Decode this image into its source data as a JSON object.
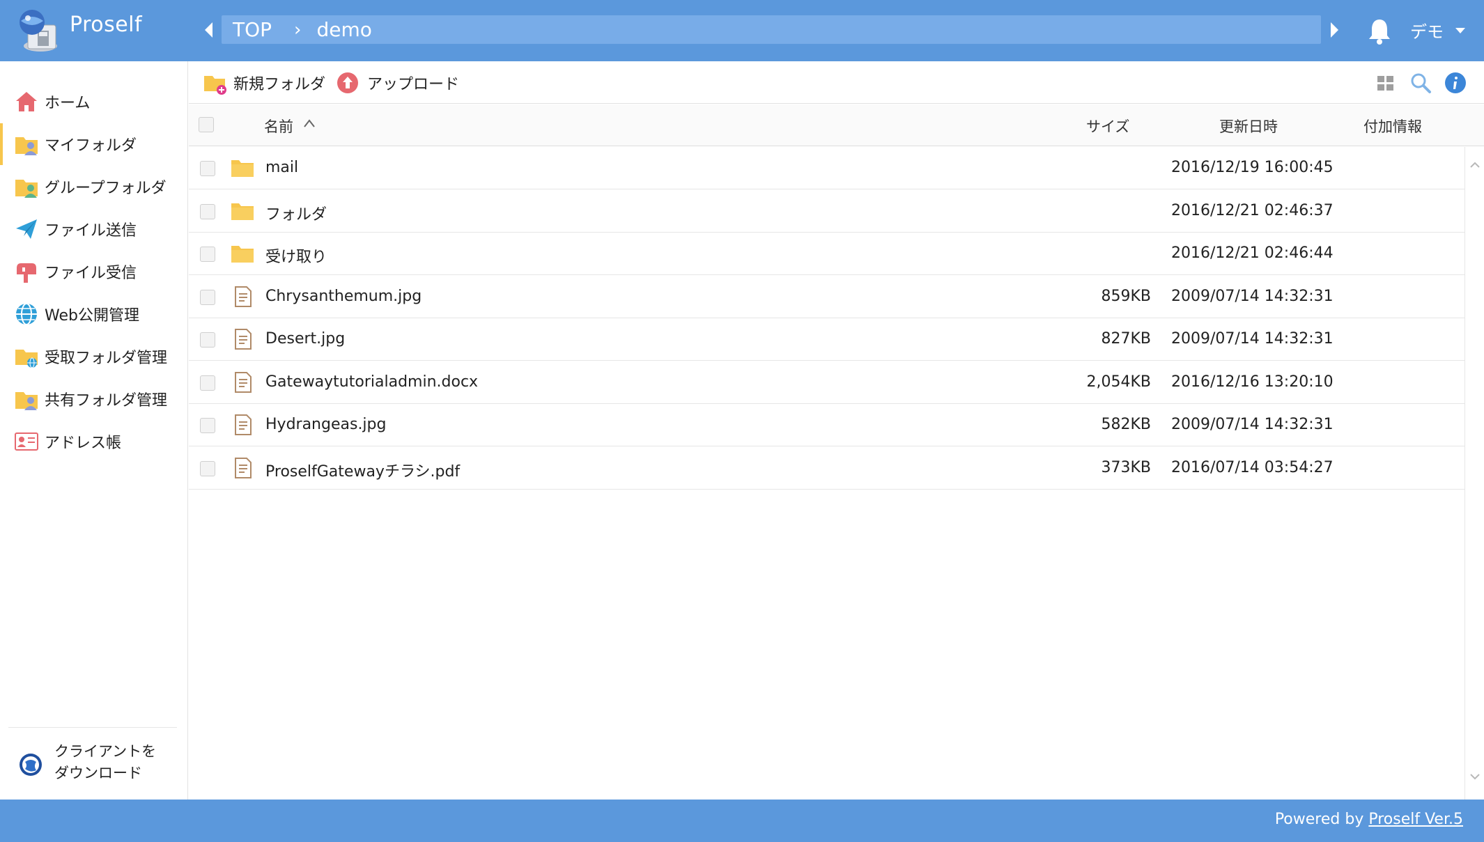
{
  "header": {
    "app_title": "Proself",
    "breadcrumbs": [
      "TOP",
      "demo"
    ],
    "user_label": "デモ"
  },
  "sidebar": {
    "items": [
      {
        "label": "ホーム",
        "icon": "home-icon"
      },
      {
        "label": "マイフォルダ",
        "icon": "my-folder-icon"
      },
      {
        "label": "グループフォルダ",
        "icon": "group-folder-icon"
      },
      {
        "label": "ファイル送信",
        "icon": "send-icon"
      },
      {
        "label": "ファイル受信",
        "icon": "mailbox-icon"
      },
      {
        "label": "Web公開管理",
        "icon": "globe-icon"
      },
      {
        "label": "受取フォルダ管理",
        "icon": "receive-folder-icon"
      },
      {
        "label": "共有フォルダ管理",
        "icon": "shared-folder-icon"
      },
      {
        "label": "アドレス帳",
        "icon": "address-book-icon"
      }
    ],
    "client_download": {
      "line1": "クライアントを",
      "line2": "ダウンロード"
    }
  },
  "toolbar": {
    "new_folder": "新規フォルダ",
    "upload": "アップロード"
  },
  "table": {
    "columns": {
      "name": "名前",
      "size": "サイズ",
      "updated": "更新日時",
      "extra": "付加情報"
    },
    "rows": [
      {
        "type": "folder",
        "name": "mail",
        "size": "",
        "updated": "2016/12/19 16:00:45"
      },
      {
        "type": "folder",
        "name": "フォルダ",
        "size": "",
        "updated": "2016/12/21 02:46:37"
      },
      {
        "type": "folder",
        "name": "受け取り",
        "size": "",
        "updated": "2016/12/21 02:46:44"
      },
      {
        "type": "file",
        "name": "Chrysanthemum.jpg",
        "size": "859KB",
        "updated": "2009/07/14 14:32:31"
      },
      {
        "type": "file",
        "name": "Desert.jpg",
        "size": "827KB",
        "updated": "2009/07/14 14:32:31"
      },
      {
        "type": "file",
        "name": "Gatewaytutorialadmin.docx",
        "size": "2,054KB",
        "updated": "2016/12/16 13:20:10"
      },
      {
        "type": "file",
        "name": "Hydrangeas.jpg",
        "size": "582KB",
        "updated": "2009/07/14 14:32:31"
      },
      {
        "type": "file",
        "name": "ProselfGatewayチラシ.pdf",
        "size": "373KB",
        "updated": "2016/07/14 03:54:27"
      }
    ]
  },
  "footer": {
    "powered_by": "Powered by",
    "link": "Proself Ver.5"
  },
  "colors": {
    "header": "#5b98dc",
    "breadcrumb_bar": "#78ace8",
    "folder": "#f7c64d",
    "active_indicator": "#f7c64d"
  }
}
